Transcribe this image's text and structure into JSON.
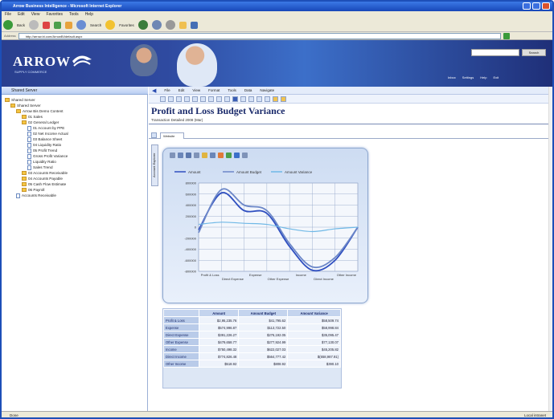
{
  "window": {
    "title": "Arrow Business Intelligence - Microsoft Internet Explorer"
  },
  "menu": [
    "File",
    "Edit",
    "View",
    "Favorites",
    "Tools",
    "Help"
  ],
  "toolbar": {
    "back": "Back",
    "search": "Search",
    "favorites": "Favorites"
  },
  "address": {
    "url": "http://arrow.bi.com/ArrowBI/default.aspx"
  },
  "banner": {
    "logo": "ARROW",
    "logo_sub": "SUPPLY COMMERCE",
    "search_button": "Search",
    "links": [
      "Inbox",
      "Settings",
      "Help",
      "Exit"
    ]
  },
  "left_pane": {
    "header": "Shared Server",
    "tree": [
      {
        "label": "Shared Server",
        "depth": 0,
        "icon": "folder"
      },
      {
        "label": "Shared Server",
        "depth": 1,
        "icon": "folder"
      },
      {
        "label": "Arrow Bis Demo Content",
        "depth": 2,
        "icon": "folder"
      },
      {
        "label": "01 Sales",
        "depth": 3,
        "icon": "folder"
      },
      {
        "label": "02 General Ledger",
        "depth": 3,
        "icon": "folder"
      },
      {
        "label": "01 Account by PPE",
        "depth": 4,
        "icon": "doc"
      },
      {
        "label": "02 Net Income Actual",
        "depth": 4,
        "icon": "doc"
      },
      {
        "label": "03 Balance Sheet",
        "depth": 4,
        "icon": "doc"
      },
      {
        "label": "04 Liquidity Ratio",
        "depth": 4,
        "icon": "doc"
      },
      {
        "label": "05 Profit Trend",
        "depth": 4,
        "icon": "doc"
      },
      {
        "label": "Gross Profit Variance",
        "depth": 4,
        "icon": "doc"
      },
      {
        "label": "Liquidity Ratio",
        "depth": 4,
        "icon": "doc"
      },
      {
        "label": "Sales Trend",
        "depth": 4,
        "icon": "doc"
      },
      {
        "label": "03 Accounts Receivable",
        "depth": 3,
        "icon": "folder"
      },
      {
        "label": "04 Accounts Payable",
        "depth": 3,
        "icon": "folder"
      },
      {
        "label": "05 Cash Flow Estimate",
        "depth": 3,
        "icon": "folder"
      },
      {
        "label": "06 Payroll",
        "depth": 3,
        "icon": "folder"
      },
      {
        "label": "Accounts Receivable",
        "depth": 2,
        "icon": "doc"
      }
    ]
  },
  "report": {
    "menu": [
      "File",
      "Edit",
      "View",
      "Format",
      "Tools",
      "Data",
      "Navigate"
    ],
    "title": "Profit and Loss Budget Variance",
    "subtitle": "Transaction Detailed 2008 (Mar)",
    "tab": "Website",
    "side_tab": "Account Explorer"
  },
  "chart_data": {
    "type": "line",
    "x": [
      "Profit & Loss",
      "Direct Expense",
      "Expense",
      "Other Expense",
      "Other Income",
      "Income",
      "Direct Income",
      "Other Income"
    ],
    "categories_shown": [
      "Profit & Loss",
      "Direct Expense",
      "Expense",
      "Other Expense",
      "Income",
      "Direct Income",
      "Other Income"
    ],
    "yticks": [
      "800000",
      "600000",
      "400000",
      "200000",
      "0",
      "-200000",
      "-400000",
      "-600000",
      "-800000"
    ],
    "ylim": [
      -800000,
      800000
    ],
    "series": [
      {
        "name": "Amount",
        "values": [
          -50000,
          620000,
          300000,
          250000,
          -350000,
          -780000,
          -600000,
          0
        ]
      },
      {
        "name": "Amount Budget",
        "values": [
          -100000,
          680000,
          400000,
          300000,
          -300000,
          -720000,
          -550000,
          0
        ]
      },
      {
        "name": "Amount Variance",
        "values": [
          50000,
          90000,
          70000,
          50000,
          -30000,
          -80000,
          -30000,
          0
        ]
      }
    ],
    "colors": [
      "#2f4fc0",
      "#6c87c8",
      "#6fb8e6"
    ],
    "legend": "top",
    "grid": true
  },
  "table": {
    "headers": [
      "",
      "Amount",
      "Amount Budget",
      "Amount Variance"
    ],
    "rows": [
      [
        "Profit & Loss",
        "$2,95,235.76",
        "$41,795.62",
        "$58,509.74"
      ],
      [
        "Expense",
        "$574,996.87",
        "$113,722.50",
        "$58,998.84"
      ],
      [
        "Direct Expense",
        "$391,226.27",
        "$276,192.05",
        "$35,095.47"
      ],
      [
        "Other Expense",
        "$479,658.77",
        "$277,924.99",
        "$77,130.07"
      ],
      [
        "Income",
        "$750,498.32",
        "$622,027.03",
        "$45,205.82"
      ],
      [
        "Direct Income",
        "$774,826.48",
        "$564,777.42",
        "$(658,987.91)"
      ],
      [
        "Other Income",
        "$518.92",
        "$808.92",
        "$390.10"
      ]
    ]
  },
  "status": {
    "left": "Done",
    "right": "Local intranet"
  }
}
